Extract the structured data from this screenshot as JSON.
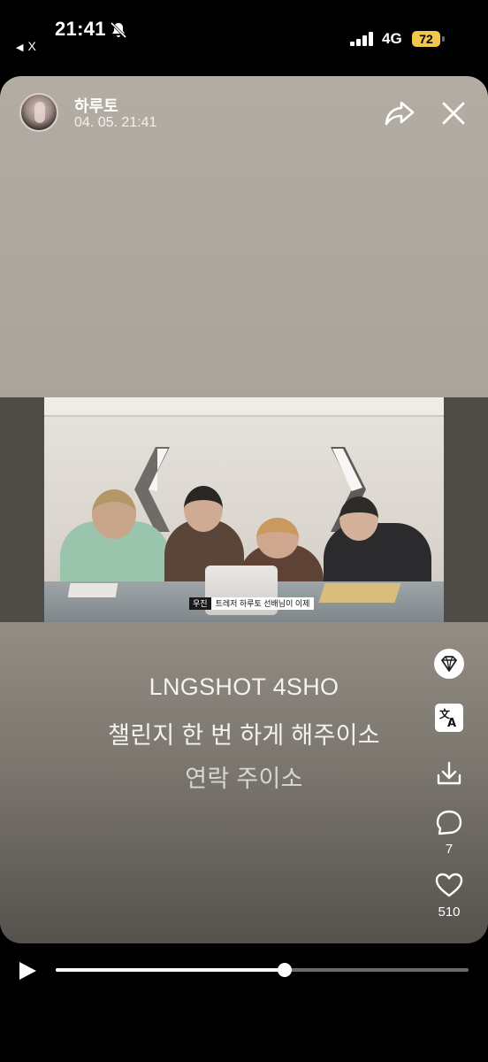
{
  "status_bar": {
    "time": "21:41",
    "back_app_label": "X",
    "network": "4G",
    "battery": "72"
  },
  "story": {
    "author": "하루토",
    "date": "04. 05. 21:41",
    "video_caption": {
      "speaker": "우진",
      "line": "트레저 하루토 선배님이 이제"
    },
    "text_lines": [
      "LNGSHOT 4SHO",
      "챌린지 한 번 하게 해주이소",
      "연락 주이소"
    ]
  },
  "actions": {
    "comments_count": "7",
    "likes_count": "510",
    "icons": [
      "gem-icon",
      "translate-icon",
      "download-icon",
      "comment-icon",
      "heart-icon",
      "share-icon",
      "close-icon",
      "play-icon"
    ]
  },
  "player": {
    "progress_fraction": 0.555
  },
  "colors": {
    "battery": "#f2c84a",
    "background": "#000000"
  }
}
